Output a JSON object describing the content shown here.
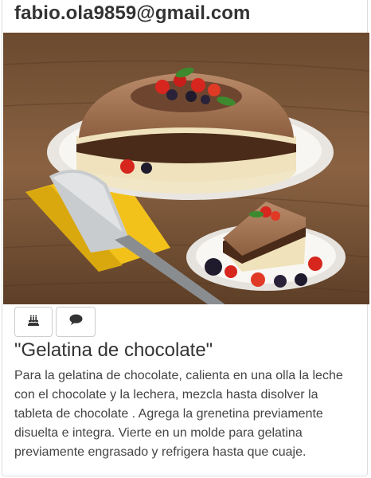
{
  "post": {
    "user_email": "fabio.ola9859@gmail.com",
    "title": "\"Gelatina de chocolate\"",
    "description": "Para la gelatina de chocolate, calienta en una olla la leche con el chocolate y la lechera, mezcla hasta disolver la tableta de chocolate . Agrega la grenetina previamente disuelta e integra. Vierte en un molde para gelatina previamente engrasado y refrigera hasta que cuaje."
  },
  "actions": {
    "cake_icon": "birthday-cake-icon",
    "comment_icon": "comment-icon"
  }
}
